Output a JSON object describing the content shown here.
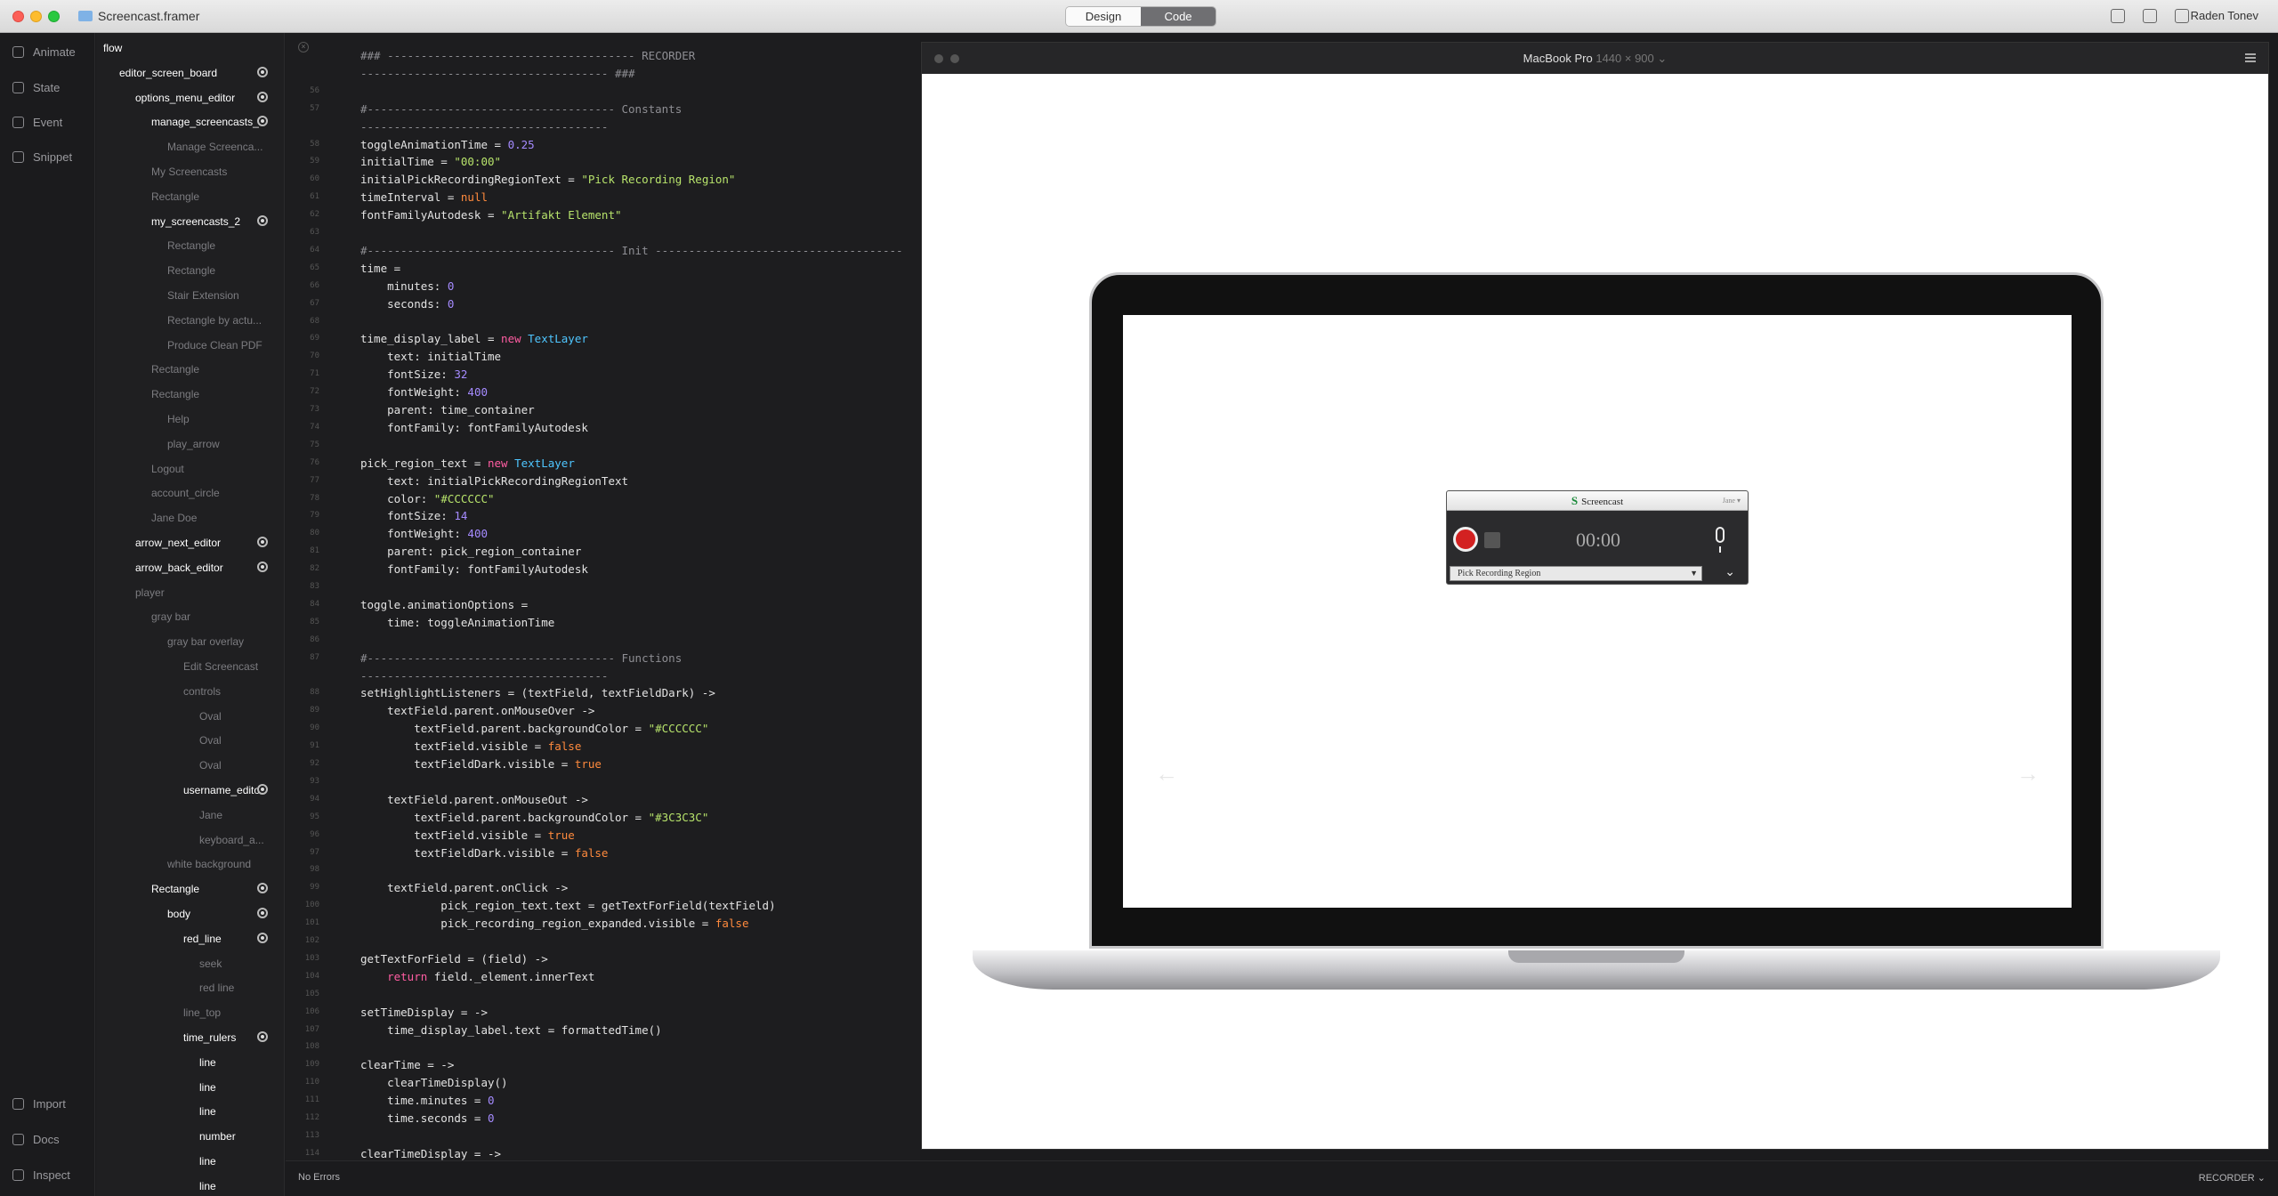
{
  "window": {
    "title": "Screencast.framer",
    "user": "Raden Tonev"
  },
  "toolbar": {
    "design_label": "Design",
    "code_label": "Code"
  },
  "nav": [
    {
      "label": "Animate"
    },
    {
      "label": "State"
    },
    {
      "label": "Event"
    },
    {
      "label": "Snippet"
    },
    {
      "label": "Import"
    },
    {
      "label": "Docs"
    },
    {
      "label": "Inspect"
    }
  ],
  "layers": [
    {
      "label": "flow",
      "indent": 0,
      "style": "bright",
      "dot": false
    },
    {
      "label": "editor_screen_board",
      "indent": 1,
      "style": "bright",
      "dot": true
    },
    {
      "label": "options_menu_editor",
      "indent": 2,
      "style": "bright",
      "dot": true
    },
    {
      "label": "manage_screencasts_2",
      "indent": 3,
      "style": "bright",
      "dot": true
    },
    {
      "label": "Manage Screenca...",
      "indent": 4,
      "style": "dim",
      "dot": false
    },
    {
      "label": "My Screencasts",
      "indent": 3,
      "style": "dim",
      "dot": false
    },
    {
      "label": "Rectangle",
      "indent": 3,
      "style": "dim",
      "dot": false
    },
    {
      "label": "my_screencasts_2",
      "indent": 3,
      "style": "bright",
      "dot": true
    },
    {
      "label": "Rectangle",
      "indent": 4,
      "style": "dim",
      "dot": false
    },
    {
      "label": "Rectangle",
      "indent": 4,
      "style": "dim",
      "dot": false
    },
    {
      "label": "Stair Extension",
      "indent": 4,
      "style": "dim",
      "dot": false
    },
    {
      "label": "Rectangle by actu...",
      "indent": 4,
      "style": "dim",
      "dot": false
    },
    {
      "label": "Produce Clean PDF",
      "indent": 4,
      "style": "dim",
      "dot": false
    },
    {
      "label": "Rectangle",
      "indent": 3,
      "style": "dim",
      "dot": false
    },
    {
      "label": "Rectangle",
      "indent": 3,
      "style": "dim",
      "dot": false
    },
    {
      "label": "Help",
      "indent": 4,
      "style": "dim",
      "dot": false
    },
    {
      "label": "play_arrow",
      "indent": 4,
      "style": "dim",
      "dot": false
    },
    {
      "label": "Logout",
      "indent": 3,
      "style": "dim",
      "dot": false
    },
    {
      "label": "account_circle",
      "indent": 3,
      "style": "dim",
      "dot": false
    },
    {
      "label": "Jane Doe",
      "indent": 3,
      "style": "dim",
      "dot": false
    },
    {
      "label": "arrow_next_editor",
      "indent": 2,
      "style": "bright",
      "dot": true
    },
    {
      "label": "arrow_back_editor",
      "indent": 2,
      "style": "bright",
      "dot": true
    },
    {
      "label": "player",
      "indent": 2,
      "style": "dim",
      "dot": false
    },
    {
      "label": "gray bar",
      "indent": 3,
      "style": "dim",
      "dot": false
    },
    {
      "label": "gray bar overlay",
      "indent": 4,
      "style": "dim",
      "dot": false
    },
    {
      "label": "Edit Screencast",
      "indent": 5,
      "style": "dim",
      "dot": false
    },
    {
      "label": "controls",
      "indent": 5,
      "style": "dim",
      "dot": false
    },
    {
      "label": "Oval",
      "indent": 6,
      "style": "dim",
      "dot": false
    },
    {
      "label": "Oval",
      "indent": 6,
      "style": "dim",
      "dot": false
    },
    {
      "label": "Oval",
      "indent": 6,
      "style": "dim",
      "dot": false
    },
    {
      "label": "username_editor",
      "indent": 5,
      "style": "bright",
      "dot": true
    },
    {
      "label": "Jane",
      "indent": 6,
      "style": "dim",
      "dot": false
    },
    {
      "label": "keyboard_a...",
      "indent": 6,
      "style": "dim",
      "dot": false
    },
    {
      "label": "white background",
      "indent": 4,
      "style": "dim",
      "dot": false
    },
    {
      "label": "Rectangle",
      "indent": 3,
      "style": "bright",
      "dot": true
    },
    {
      "label": "body",
      "indent": 4,
      "style": "bright",
      "dot": true
    },
    {
      "label": "red_line",
      "indent": 5,
      "style": "bright",
      "dot": true
    },
    {
      "label": "seek",
      "indent": 6,
      "style": "dim",
      "dot": false
    },
    {
      "label": "red line",
      "indent": 6,
      "style": "dim",
      "dot": false
    },
    {
      "label": "line_top",
      "indent": 5,
      "style": "dim",
      "dot": false
    },
    {
      "label": "time_rulers",
      "indent": 5,
      "style": "bright",
      "dot": true
    },
    {
      "label": "line",
      "indent": 6,
      "style": "bright",
      "dot": false
    },
    {
      "label": "line",
      "indent": 6,
      "style": "bright",
      "dot": false
    },
    {
      "label": "line",
      "indent": 6,
      "style": "bright",
      "dot": false
    },
    {
      "label": "number",
      "indent": 6,
      "style": "bright",
      "dot": false
    },
    {
      "label": "line",
      "indent": 6,
      "style": "bright",
      "dot": false
    },
    {
      "label": "line",
      "indent": 6,
      "style": "bright",
      "dot": false
    }
  ],
  "code": [
    {
      "n": "",
      "t": "### ------------------------------------- RECORDER",
      "c": "cm"
    },
    {
      "n": "",
      "t": "------------------------------------- ###",
      "c": "cm"
    },
    {
      "n": "56",
      "t": "",
      "c": ""
    },
    {
      "n": "57",
      "t": "#------------------------------------- Constants",
      "c": "cm"
    },
    {
      "n": "",
      "t": "-------------------------------------",
      "c": "cm"
    },
    {
      "n": "58",
      "t": "toggleAnimationTime = 0.25",
      "c": ""
    },
    {
      "n": "59",
      "t": "initialTime = \"00:00\"",
      "c": ""
    },
    {
      "n": "60",
      "t": "initialPickRecordingRegionText = \"Pick Recording Region\"",
      "c": ""
    },
    {
      "n": "61",
      "t": "timeInterval = null",
      "c": ""
    },
    {
      "n": "62",
      "t": "fontFamilyAutodesk = \"Artifakt Element\"",
      "c": ""
    },
    {
      "n": "63",
      "t": "",
      "c": ""
    },
    {
      "n": "64",
      "t": "#------------------------------------- Init -------------------------------------",
      "c": "cm"
    },
    {
      "n": "65",
      "t": "time =",
      "c": ""
    },
    {
      "n": "66",
      "t": "    minutes: 0",
      "c": ""
    },
    {
      "n": "67",
      "t": "    seconds: 0",
      "c": ""
    },
    {
      "n": "68",
      "t": "",
      "c": ""
    },
    {
      "n": "69",
      "t": "time_display_label = new TextLayer",
      "c": ""
    },
    {
      "n": "70",
      "t": "    text: initialTime",
      "c": ""
    },
    {
      "n": "71",
      "t": "    fontSize: 32",
      "c": ""
    },
    {
      "n": "72",
      "t": "    fontWeight: 400",
      "c": ""
    },
    {
      "n": "73",
      "t": "    parent: time_container",
      "c": ""
    },
    {
      "n": "74",
      "t": "    fontFamily: fontFamilyAutodesk",
      "c": ""
    },
    {
      "n": "75",
      "t": "",
      "c": ""
    },
    {
      "n": "76",
      "t": "pick_region_text = new TextLayer",
      "c": ""
    },
    {
      "n": "77",
      "t": "    text: initialPickRecordingRegionText",
      "c": ""
    },
    {
      "n": "78",
      "t": "    color: \"#CCCCCC\"",
      "c": ""
    },
    {
      "n": "79",
      "t": "    fontSize: 14",
      "c": ""
    },
    {
      "n": "80",
      "t": "    fontWeight: 400",
      "c": ""
    },
    {
      "n": "81",
      "t": "    parent: pick_region_container",
      "c": ""
    },
    {
      "n": "82",
      "t": "    fontFamily: fontFamilyAutodesk",
      "c": ""
    },
    {
      "n": "83",
      "t": "",
      "c": ""
    },
    {
      "n": "84",
      "t": "toggle.animationOptions =",
      "c": ""
    },
    {
      "n": "85",
      "t": "    time: toggleAnimationTime",
      "c": ""
    },
    {
      "n": "86",
      "t": "",
      "c": ""
    },
    {
      "n": "87",
      "t": "#------------------------------------- Functions",
      "c": "cm"
    },
    {
      "n": "",
      "t": "-------------------------------------",
      "c": "cm"
    },
    {
      "n": "88",
      "t": "setHighlightListeners = (textField, textFieldDark) ->",
      "c": ""
    },
    {
      "n": "89",
      "t": "    textField.parent.onMouseOver ->",
      "c": ""
    },
    {
      "n": "90",
      "t": "        textField.parent.backgroundColor = \"#CCCCCC\"",
      "c": ""
    },
    {
      "n": "91",
      "t": "        textField.visible = false",
      "c": ""
    },
    {
      "n": "92",
      "t": "        textFieldDark.visible = true",
      "c": ""
    },
    {
      "n": "93",
      "t": "",
      "c": ""
    },
    {
      "n": "94",
      "t": "    textField.parent.onMouseOut ->",
      "c": ""
    },
    {
      "n": "95",
      "t": "        textField.parent.backgroundColor = \"#3C3C3C\"",
      "c": ""
    },
    {
      "n": "96",
      "t": "        textField.visible = true",
      "c": ""
    },
    {
      "n": "97",
      "t": "        textFieldDark.visible = false",
      "c": ""
    },
    {
      "n": "98",
      "t": "",
      "c": ""
    },
    {
      "n": "99",
      "t": "    textField.parent.onClick ->",
      "c": ""
    },
    {
      "n": "100",
      "t": "            pick_region_text.text = getTextForField(textField)",
      "c": ""
    },
    {
      "n": "101",
      "t": "            pick_recording_region_expanded.visible = false",
      "c": ""
    },
    {
      "n": "102",
      "t": "",
      "c": ""
    },
    {
      "n": "103",
      "t": "getTextForField = (field) ->",
      "c": ""
    },
    {
      "n": "104",
      "t": "    return field._element.innerText",
      "c": ""
    },
    {
      "n": "105",
      "t": "",
      "c": ""
    },
    {
      "n": "106",
      "t": "setTimeDisplay = ->",
      "c": ""
    },
    {
      "n": "107",
      "t": "    time_display_label.text = formattedTime()",
      "c": ""
    },
    {
      "n": "108",
      "t": "",
      "c": ""
    },
    {
      "n": "109",
      "t": "clearTime = ->",
      "c": ""
    },
    {
      "n": "110",
      "t": "    clearTimeDisplay()",
      "c": ""
    },
    {
      "n": "111",
      "t": "    time.minutes = 0",
      "c": ""
    },
    {
      "n": "112",
      "t": "    time.seconds = 0",
      "c": ""
    },
    {
      "n": "113",
      "t": "",
      "c": ""
    },
    {
      "n": "114",
      "t": "clearTimeDisplay = ->",
      "c": ""
    }
  ],
  "status": {
    "left": "No Errors",
    "right": "RECORDER"
  },
  "preview": {
    "device": "MacBook Pro",
    "resolution": "1440 × 900"
  },
  "widget": {
    "app_name": "Screencast",
    "user": "Jane",
    "time": "00:00",
    "region": "Pick Recording Region"
  },
  "colors": {
    "accent": "#6f6f72",
    "record": "#d32121",
    "keyword": "#ff5da2",
    "number": "#a58bff",
    "string": "#b7e36b"
  }
}
